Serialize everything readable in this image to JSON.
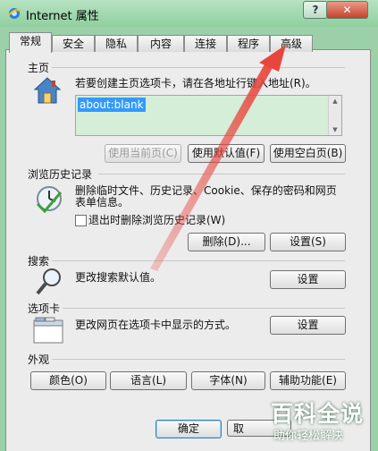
{
  "window": {
    "title": "Internet 属性",
    "help_label": "?",
    "close_label": "✕"
  },
  "tabs": [
    "常规",
    "安全",
    "隐私",
    "内容",
    "连接",
    "程序",
    "高级"
  ],
  "homepage": {
    "group_title": "主页",
    "description": "若要创建主页选项卡，请在各地址行键入地址(R)。",
    "url_value": "about:blank",
    "btn_use_current": "使用当前页(C)",
    "btn_use_default": "使用默认值(F)",
    "btn_use_blank": "使用空白页(B)"
  },
  "history": {
    "group_title": "浏览历史记录",
    "description_line1": "删除临时文件、历史记录、Cookie、保存的密码和网页",
    "description_line2": "表单信息。",
    "checkbox_label": "退出时删除浏览历史记录(W)",
    "btn_delete": "删除(D)...",
    "btn_settings": "设置(S)"
  },
  "search": {
    "group_title": "搜索",
    "description": "更改搜索默认值。",
    "btn_settings": "设置"
  },
  "tabs_group": {
    "group_title": "选项卡",
    "description": "更改网页在选项卡中显示的方式。",
    "btn_settings": "设置"
  },
  "appearance": {
    "group_title": "外观",
    "btn_colors": "颜色(O)",
    "btn_languages": "语言(L)",
    "btn_fonts": "字体(N)",
    "btn_accessibility": "辅助功能(E)"
  },
  "footer": {
    "btn_ok": "确定",
    "btn_cancel": "取"
  },
  "watermark": {
    "main": "百科全说",
    "sub": "助你轻松解决"
  },
  "colors": {
    "title_bar": "#8fcf9f",
    "url_highlight": "#3399ff",
    "annotation_arrow": "#e8453c"
  }
}
